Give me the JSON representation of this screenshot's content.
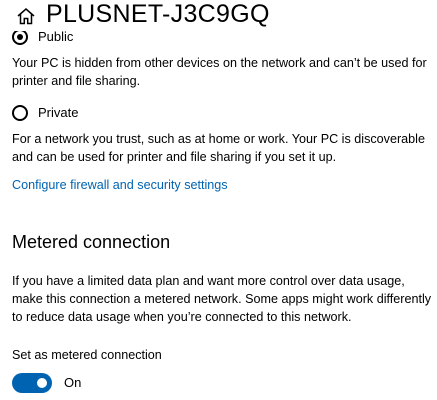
{
  "header": {
    "title": "PLUSNET-J3C9GQ",
    "icon": "home-icon"
  },
  "network_profile": {
    "options": [
      {
        "label": "Public",
        "selected": true,
        "description": "Your PC is hidden from other devices on the network and can’t be used for printer and file sharing."
      },
      {
        "label": "Private",
        "selected": false,
        "description": "For a network you trust, such as at home or work. Your PC is discoverable and can be used for printer and file sharing if you set it up."
      }
    ],
    "firewall_link": "Configure firewall and security settings"
  },
  "metered": {
    "heading": "Metered connection",
    "description": "If you have a limited data plan and want more control over data usage, make this connection a metered network. Some apps might work differently to reduce data usage when you’re connected to this network.",
    "toggle_title": "Set as metered connection",
    "toggle_state_label": "On",
    "toggle_on": true
  },
  "colors": {
    "accent": "#0063b1",
    "link": "#0063b1",
    "text": "#000000",
    "background": "#ffffff"
  }
}
